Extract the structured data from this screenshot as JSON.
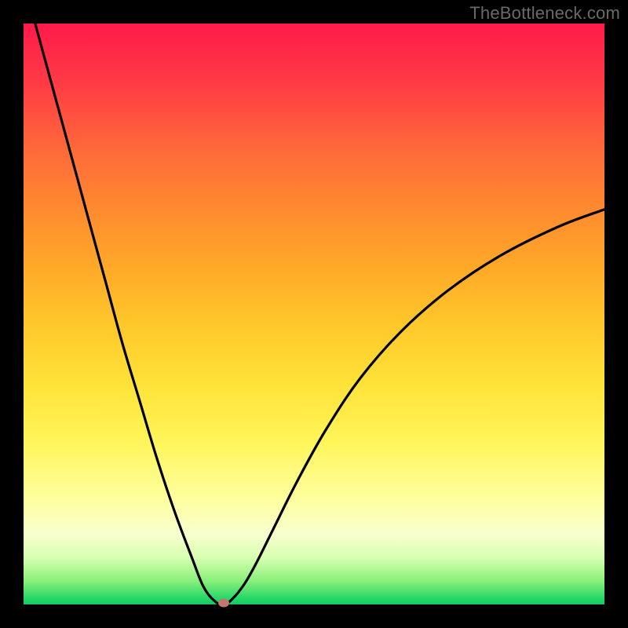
{
  "watermark": "TheBottleneck.com",
  "chart_data": {
    "type": "line",
    "title": "",
    "xlabel": "",
    "ylabel": "",
    "xlim": [
      0,
      100
    ],
    "ylim": [
      0,
      100
    ],
    "grid": false,
    "legend": false,
    "series": [
      {
        "name": "bottleneck-curve",
        "x": [
          2,
          5,
          8,
          11,
          14,
          17,
          20,
          23,
          26,
          29,
          31,
          33,
          34.5,
          36,
          38,
          40,
          43,
          47,
          52,
          58,
          65,
          73,
          82,
          92,
          100
        ],
        "y": [
          100,
          89,
          78,
          67,
          56,
          45,
          35,
          25,
          16,
          8,
          3,
          0.5,
          0,
          1,
          3.5,
          7,
          13,
          21,
          30,
          39,
          47,
          54,
          60,
          65,
          68
        ]
      }
    ],
    "annotations": [
      {
        "name": "minimum-point",
        "x": 34.5,
        "y": 0,
        "color": "#c2776c"
      }
    ],
    "gradient_colors": {
      "top": "#ff1a4a",
      "mid": "#ffe238",
      "bottom": "#14c95c"
    }
  }
}
